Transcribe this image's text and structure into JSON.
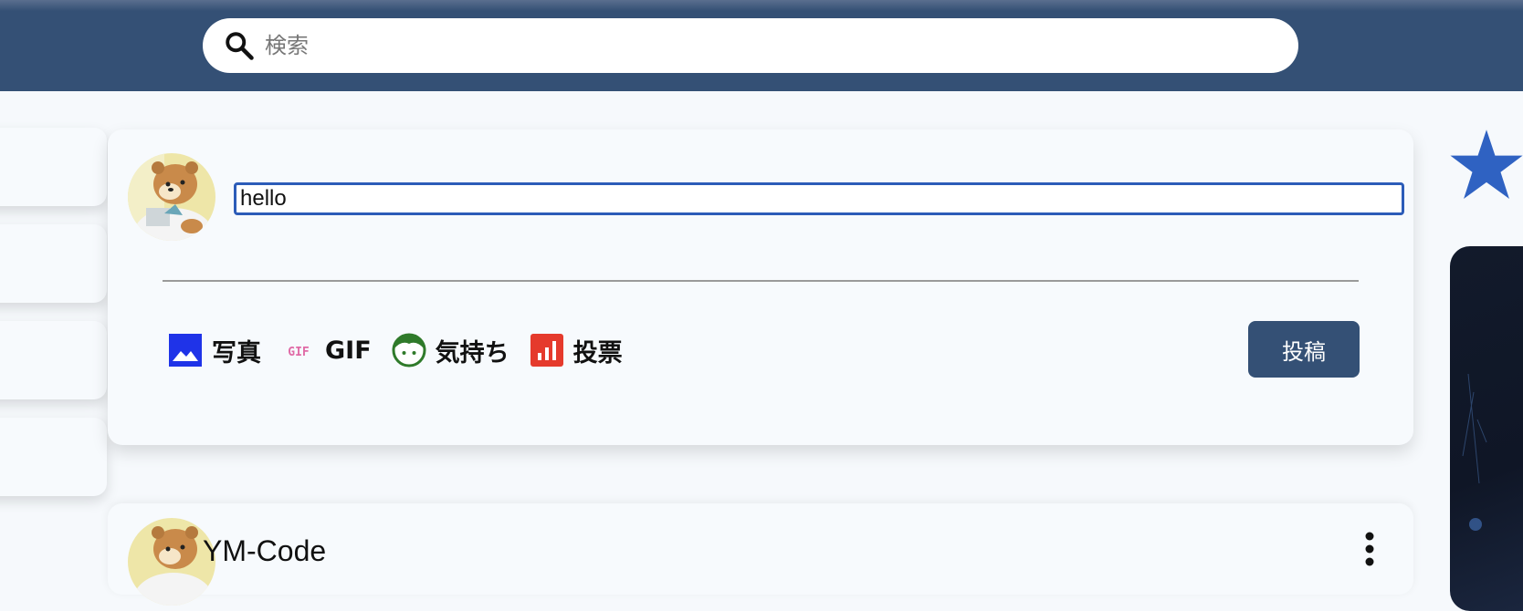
{
  "search": {
    "placeholder": "検索"
  },
  "composer": {
    "input_value": "hello",
    "actions": [
      {
        "label": "写真",
        "icon": "photo-icon",
        "color": "#1f33e8"
      },
      {
        "label": "GIF",
        "icon": "gif-icon",
        "color": "#e06aa6"
      },
      {
        "label": "気持ち",
        "icon": "feeling-face-icon",
        "color": "#2f7a2a"
      },
      {
        "label": "投票",
        "icon": "poll-icon",
        "color": "#e53a2c"
      }
    ],
    "post_button": "投稿"
  },
  "feed": {
    "items": [
      {
        "author": "YM-Code"
      }
    ]
  },
  "colors": {
    "header": "#345075",
    "accent_star": "#2f62c2",
    "post_button": "#345075"
  }
}
